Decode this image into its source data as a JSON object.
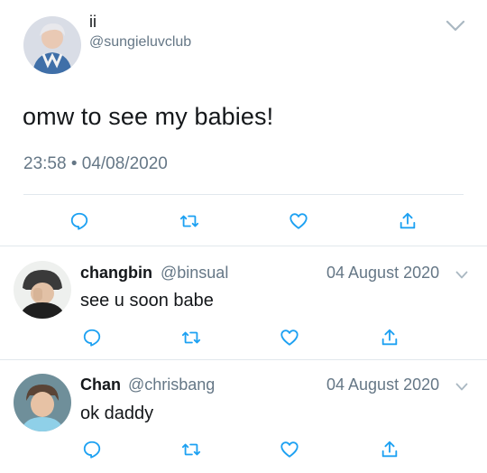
{
  "main_tweet": {
    "display_name": "ii",
    "handle": "@sungieluvclub",
    "text": "omw to see my babies!",
    "timestamp": "23:58 • 04/08/2020",
    "actions": [
      "reply-icon",
      "retweet-icon",
      "like-icon",
      "share-icon"
    ]
  },
  "replies": [
    {
      "display_name": "changbin",
      "handle": "@binsual",
      "date": "04 August 2020",
      "text": "see u soon babe"
    },
    {
      "display_name": "Chan",
      "handle": "@chrisbang",
      "date": "04 August 2020",
      "text": "ok daddy"
    }
  ],
  "colors": {
    "text": "#14171a",
    "secondary": "#657786",
    "divider": "#e1e8ed",
    "icon": "#1da1f2"
  }
}
